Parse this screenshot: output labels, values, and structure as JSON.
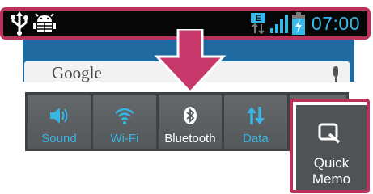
{
  "status_bar": {
    "time": "07:00",
    "left_icons": [
      "usb-icon",
      "android-debug-icon"
    ],
    "right_icons": [
      "data-transfer-icon",
      "signal-icon",
      "battery-charging-icon"
    ],
    "data_network_label": "E",
    "accent_color": "#35b8ea"
  },
  "home": {
    "search_text": "Google"
  },
  "quick_settings": {
    "tiles": [
      {
        "label": "Sound",
        "icon": "volume-icon",
        "active": true
      },
      {
        "label": "Wi-Fi",
        "icon": "wifi-icon",
        "active": true
      },
      {
        "label": "Bluetooth",
        "icon": "bluetooth-icon",
        "active": false
      },
      {
        "label": "Data",
        "icon": "data-arrows-icon",
        "active": true
      }
    ]
  },
  "quick_memo": {
    "line1": "Quick",
    "line2": "Memo",
    "icon": "quickmemo-icon"
  },
  "highlight_color": "#b8325a"
}
